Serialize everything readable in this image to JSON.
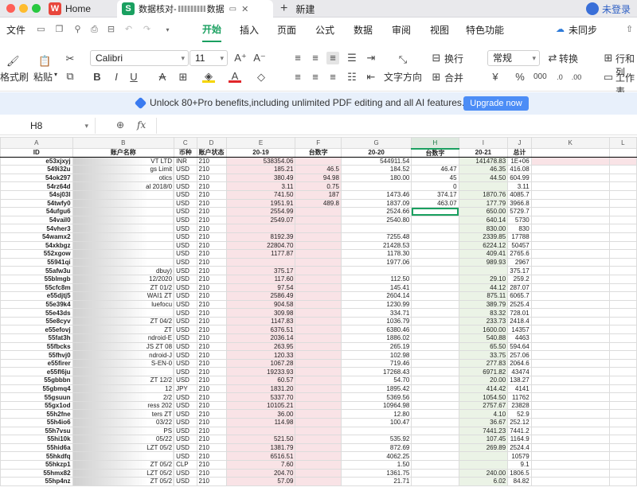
{
  "tabs": {
    "home_label": "Home",
    "doc_label": "数据核对-",
    "doc_label_tail": "数据",
    "new_label": "新建"
  },
  "account": {
    "login_label": "未登录"
  },
  "menu": {
    "file": "文件",
    "items": [
      "开始",
      "插入",
      "页面",
      "公式",
      "数据",
      "审阅",
      "视图",
      "特色功能"
    ],
    "sync": "未同步"
  },
  "ribbon": {
    "format_painter": "格式刷",
    "paste": "粘贴",
    "font_name": "Calibri",
    "font_size": "11",
    "wrap": "换行",
    "text_direction": "文字方向",
    "merge": "合并",
    "number_format": "常规",
    "convert": "转换",
    "rows_cols": "行和列",
    "worksheet": "工作表"
  },
  "banner": {
    "text": "Unlock 80+Pro benefits,including unlimited PDF editing and all AI features.",
    "button": "Upgrade now"
  },
  "formula_bar": {
    "cell_ref": "H8",
    "fx": "fx"
  },
  "sheet": {
    "columns": [
      "A",
      "B",
      "C",
      "D",
      "E",
      "F",
      "G",
      "H",
      "I",
      "J",
      "K",
      "L"
    ],
    "headers": [
      "ID",
      "账户名称",
      "币种",
      "账户状态",
      "20",
      "台数字",
      "20",
      "台数字",
      "20",
      "总计",
      "",
      ""
    ],
    "header_suffixes": [
      "",
      "",
      "",
      "",
      "-19",
      "",
      "-20",
      "",
      "-21",
      "",
      "",
      ""
    ],
    "rows": [
      [
        "e53xjxyj",
        "VT LTD",
        "INR",
        "210",
        "538354.06",
        "",
        "544911.54",
        "",
        "141478.83",
        "1E+06"
      ],
      [
        "549i32u",
        "gs Limit",
        "USD",
        "210",
        "185.21",
        "46.5",
        "184.52",
        "46.47",
        "46.35",
        "416.08"
      ],
      [
        "54ok297",
        "otics",
        "USD",
        "210",
        "380.49",
        "94.98",
        "180.00",
        "45",
        "44.50",
        "604.99"
      ],
      [
        "54rz64d",
        "al 2018/0",
        "USD",
        "210",
        "3.11",
        "0.75",
        "",
        "0",
        "",
        "3.11"
      ],
      [
        "54sj03l",
        "",
        "USD",
        "210",
        "741.50",
        "187",
        "1473.46",
        "374.17",
        "1870.76",
        "4085.7"
      ],
      [
        "54twfy0",
        "",
        "USD",
        "210",
        "1951.91",
        "489.8",
        "1837.09",
        "463.07",
        "177.79",
        "3966.8"
      ],
      [
        "54ufgu6",
        "",
        "USD",
        "210",
        "2554.99",
        "",
        "2524.66",
        "",
        "650.00",
        "5729.7"
      ],
      [
        "54vail0",
        "",
        "USD",
        "210",
        "2549.07",
        "",
        "2540.80",
        "",
        "640.14",
        "5730"
      ],
      [
        "54vher3",
        "",
        "USD",
        "210",
        "",
        "",
        "",
        "",
        "830.00",
        "830"
      ],
      [
        "54wamx2",
        "",
        "USD",
        "210",
        "8192.39",
        "",
        "7255.48",
        "",
        "2339.85",
        "17788"
      ],
      [
        "54xkbgz",
        "",
        "USD",
        "210",
        "22804.70",
        "",
        "21428.53",
        "",
        "6224.12",
        "50457"
      ],
      [
        "552xgow",
        "",
        "USD",
        "210",
        "1177.87",
        "",
        "1178.30",
        "",
        "409.41",
        "2765.6"
      ],
      [
        "55941qi",
        "",
        "USD",
        "210",
        "",
        "",
        "1977.06",
        "",
        "989.93",
        "2967"
      ],
      [
        "55afw3u",
        "dbuy)",
        "USD",
        "210",
        "375.17",
        "",
        "",
        "",
        "",
        "375.17"
      ],
      [
        "55blmgb",
        "12/2020",
        "USD",
        "210",
        "117.60",
        "",
        "112.50",
        "",
        "29.10",
        "259.2"
      ],
      [
        "55cfc8m",
        "ZT 01/2",
        "USD",
        "210",
        "97.54",
        "",
        "145.41",
        "",
        "44.12",
        "287.07"
      ],
      [
        "e55djtj5",
        "WAI1 ZT",
        "USD",
        "210",
        "2586.49",
        "",
        "2604.14",
        "",
        "875.11",
        "6065.7"
      ],
      [
        "55e39k4",
        "luefocu",
        "USD",
        "210",
        "904.58",
        "",
        "1230.99",
        "",
        "389.79",
        "2525.4"
      ],
      [
        "55e43ds",
        "",
        "USD",
        "210",
        "309.98",
        "",
        "334.71",
        "",
        "83.32",
        "728.01"
      ],
      [
        "55e8cyv",
        "ZT 04/2",
        "USD",
        "210",
        "1147.83",
        "",
        "1036.79",
        "",
        "233.73",
        "2418.4"
      ],
      [
        "e55efovj",
        "ZT",
        "USD",
        "210",
        "6376.51",
        "",
        "6380.46",
        "",
        "1600.00",
        "14357"
      ],
      [
        "55fat3h",
        "ndroid-E",
        "USD",
        "210",
        "2036.14",
        "",
        "1886.02",
        "",
        "540.88",
        "4463"
      ],
      [
        "55fbcks",
        "JS ZT 08",
        "USD",
        "210",
        "263.95",
        "",
        "265.19",
        "",
        "65.50",
        "594.64"
      ],
      [
        "55fhvj0",
        "ndroid-J",
        "USD",
        "210",
        "120.33",
        "",
        "102.98",
        "",
        "33.75",
        "257.06"
      ],
      [
        "e55firer",
        "S-EN-0",
        "USD",
        "210",
        "1067.28",
        "",
        "719.46",
        "",
        "277.83",
        "2064.6"
      ],
      [
        "e55fl6ju",
        "",
        "USD",
        "210",
        "19233.93",
        "",
        "17268.43",
        "",
        "6971.82",
        "43474"
      ],
      [
        "55gbbbn",
        "ZT 12/2",
        "USD",
        "210",
        "60.57",
        "",
        "54.70",
        "",
        "20.00",
        "138.27"
      ],
      [
        "55gbmq4",
        "12",
        "JPY",
        "210",
        "1831.20",
        "",
        "1895.42",
        "",
        "414.42",
        "4141"
      ],
      [
        "55gsuun",
        "2/2",
        "USD",
        "210",
        "5337.70",
        "",
        "5369.56",
        "",
        "1054.50",
        "11762"
      ],
      [
        "55gx1od",
        "ress 202",
        "USD",
        "210",
        "10105.21",
        "",
        "10964.98",
        "",
        "2757.67",
        "23828"
      ],
      [
        "55h2fne",
        "ters ZT",
        "USD",
        "210",
        "36.00",
        "",
        "12.80",
        "",
        "4.10",
        "52.9"
      ],
      [
        "55h4io6",
        "03/22",
        "USD",
        "210",
        "114.98",
        "",
        "100.47",
        "",
        "36.67",
        "252.12"
      ],
      [
        "55h7vsu",
        "PS",
        "USD",
        "210",
        "",
        "",
        "",
        "",
        "7441.23",
        "7441.2"
      ],
      [
        "55hi10k",
        "05/22",
        "USD",
        "210",
        "521.50",
        "",
        "535.92",
        "",
        "107.45",
        "1164.9"
      ],
      [
        "55hid6a",
        "LZT 05/2",
        "USD",
        "210",
        "1381.79",
        "",
        "872.69",
        "",
        "269.89",
        "2524.4"
      ],
      [
        "55hkdfq",
        "",
        "USD",
        "210",
        "6516.51",
        "",
        "4062.25",
        "",
        "",
        "10579"
      ],
      [
        "55hkzp1",
        "ZT 05/2",
        "CLP",
        "210",
        "7.60",
        "",
        "1.50",
        "",
        "",
        "9.1"
      ],
      [
        "55hmx82",
        "LZT 05/2",
        "USD",
        "210",
        "204.70",
        "",
        "1361.75",
        "",
        "240.00",
        "1806.5"
      ],
      [
        "55hp4nz",
        "ZT 05/2",
        "USD",
        "210",
        "57.09",
        "",
        "21.71",
        "",
        "6.02",
        "84.82"
      ]
    ]
  }
}
